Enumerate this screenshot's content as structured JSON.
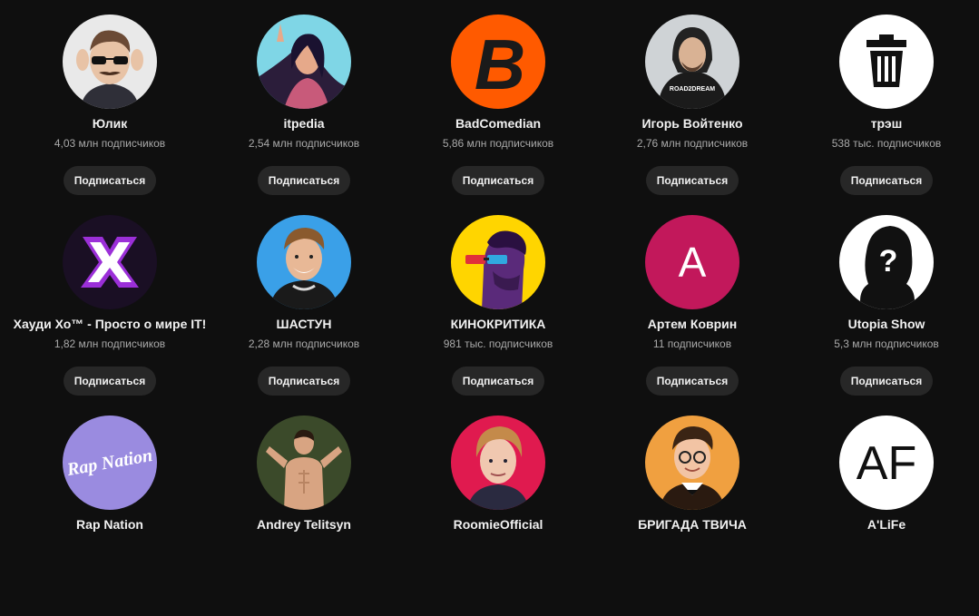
{
  "subscribe_label": "Подписаться",
  "channels": [
    {
      "name": "Юлик",
      "subscribers": "4,03 млн подписчиков",
      "avatar_icon": "man-sunglasses-avatar",
      "avatar_bg": "#e9e9e9"
    },
    {
      "name": "itpedia",
      "subscribers": "2,54 млн подписчиков",
      "avatar_icon": "woman-illustration-avatar",
      "avatar_bg": "#7fd6e6"
    },
    {
      "name": "BadComedian",
      "subscribers": "5,86 млн подписчиков",
      "avatar_icon": "letter-b-logo",
      "avatar_bg": "#ff5a00",
      "avatar_letter": "B"
    },
    {
      "name": "Игорь Войтенко",
      "subscribers": "2,76 млн подписчиков",
      "avatar_icon": "man-hoodie-avatar",
      "avatar_bg": "#cfd3d6",
      "avatar_text": "ROAD2DREAM"
    },
    {
      "name": "трэш",
      "subscribers": "538 тыс. подписчиков",
      "avatar_icon": "trash-can-logo",
      "avatar_bg": "#ffffff"
    },
    {
      "name": "Хауди Хо™ - Просто о мире IT!",
      "subscribers": "1,82 млн подписчиков",
      "avatar_icon": "x-logo",
      "avatar_bg": "#1a0f24"
    },
    {
      "name": "ШАСТУН",
      "subscribers": "2,28 млн подписчиков",
      "avatar_icon": "man-smiling-avatar",
      "avatar_bg": "#3aa0e8"
    },
    {
      "name": "КИНОКРИТИКА",
      "subscribers": "981 тыс. подписчиков",
      "avatar_icon": "man-3d-glasses-logo",
      "avatar_bg": "#ffd500"
    },
    {
      "name": "Артем Коврин",
      "subscribers": "11 подписчиков",
      "avatar_icon": "letter-a-avatar",
      "avatar_bg": "#c2185b",
      "avatar_letter": "A"
    },
    {
      "name": "Utopia Show",
      "subscribers": "5,3 млн подписчиков",
      "avatar_icon": "question-silhouette-logo",
      "avatar_bg": "#ffffff",
      "avatar_letter": "?"
    },
    {
      "name": "Rap Nation",
      "subscribers": "",
      "avatar_icon": "rap-nation-logo",
      "avatar_bg": "#9a8be0",
      "avatar_text": "Rap Nation"
    },
    {
      "name": "Andrey Telitsyn",
      "subscribers": "",
      "avatar_icon": "shirtless-man-avatar",
      "avatar_bg": "#3b4a2a"
    },
    {
      "name": "RoomieOfficial",
      "subscribers": "",
      "avatar_icon": "man-portrait-avatar",
      "avatar_bg": "#e01a4f"
    },
    {
      "name": "БРИГАДА ТВИЧА",
      "subscribers": "",
      "avatar_icon": "cartoon-man-avatar",
      "avatar_bg": "#f0a040"
    },
    {
      "name": "A'LiFe",
      "subscribers": "",
      "avatar_icon": "af-logo",
      "avatar_bg": "#ffffff",
      "avatar_text": "AF"
    }
  ]
}
